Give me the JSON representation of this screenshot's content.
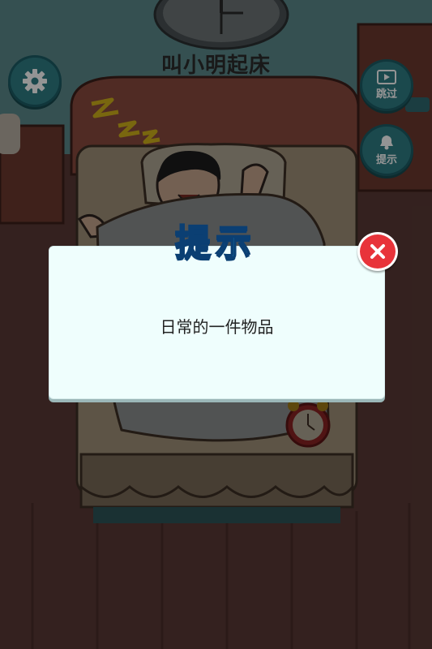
{
  "game": {
    "title": "叫小明起床"
  },
  "buttons": {
    "settings_icon": "gear-icon",
    "skip_label": "跳过",
    "skip_icon": "film-icon",
    "hint_label": "提示",
    "hint_icon": "bell-icon"
  },
  "dialog": {
    "title": "提示",
    "message": "日常的一件物品",
    "close_icon": "close-icon"
  },
  "colors": {
    "wall": "#5c8a8c",
    "floor": "#5a3a36",
    "bed_frame": "#8a4b3e",
    "button_teal": "#2f7e86",
    "dialog_bg": "#effefd",
    "title_blue": "#29b4ef",
    "close_red": "#e8333a"
  }
}
